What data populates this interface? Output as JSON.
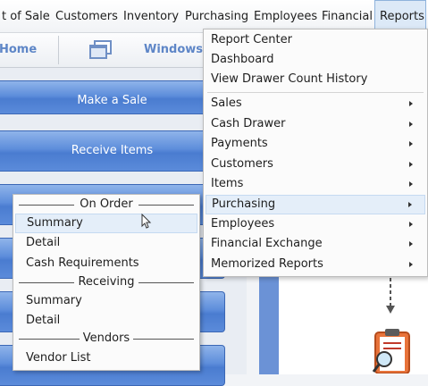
{
  "menubar": {
    "items": [
      {
        "label": "t of Sale"
      },
      {
        "label": "Customers"
      },
      {
        "label": "Inventory"
      },
      {
        "label": "Purchasing"
      },
      {
        "label": "Employees"
      },
      {
        "label": "Financial"
      },
      {
        "label": "Reports"
      }
    ]
  },
  "toolbar": {
    "home_label": "Home",
    "windows_label": "Windows"
  },
  "actions": [
    {
      "label": "Make a Sale"
    },
    {
      "label": "Receive Items"
    }
  ],
  "reports_menu": {
    "items": [
      {
        "label": "Report Center"
      },
      {
        "label": "Dashboard"
      },
      {
        "label": "View Drawer Count History"
      },
      {
        "label": "Sales"
      },
      {
        "label": "Cash Drawer"
      },
      {
        "label": "Payments"
      },
      {
        "label": "Customers"
      },
      {
        "label": "Items"
      },
      {
        "label": "Purchasing"
      },
      {
        "label": "Employees"
      },
      {
        "label": "Financial Exchange"
      },
      {
        "label": "Memorized Reports"
      }
    ]
  },
  "purchasing_submenu": {
    "groups": [
      {
        "header": "On Order",
        "items": [
          {
            "label": "Summary"
          },
          {
            "label": "Detail"
          },
          {
            "label": "Cash Requirements"
          }
        ]
      },
      {
        "header": "Receiving",
        "items": [
          {
            "label": "Summary"
          },
          {
            "label": "Detail"
          }
        ]
      },
      {
        "header": "Vendors",
        "items": [
          {
            "label": "Vendor List"
          }
        ]
      }
    ]
  },
  "colors": {
    "accent_blue": "#5d8ddb",
    "toolbar_text": "#5e86c7",
    "hover_bg": "#e4eef9"
  }
}
